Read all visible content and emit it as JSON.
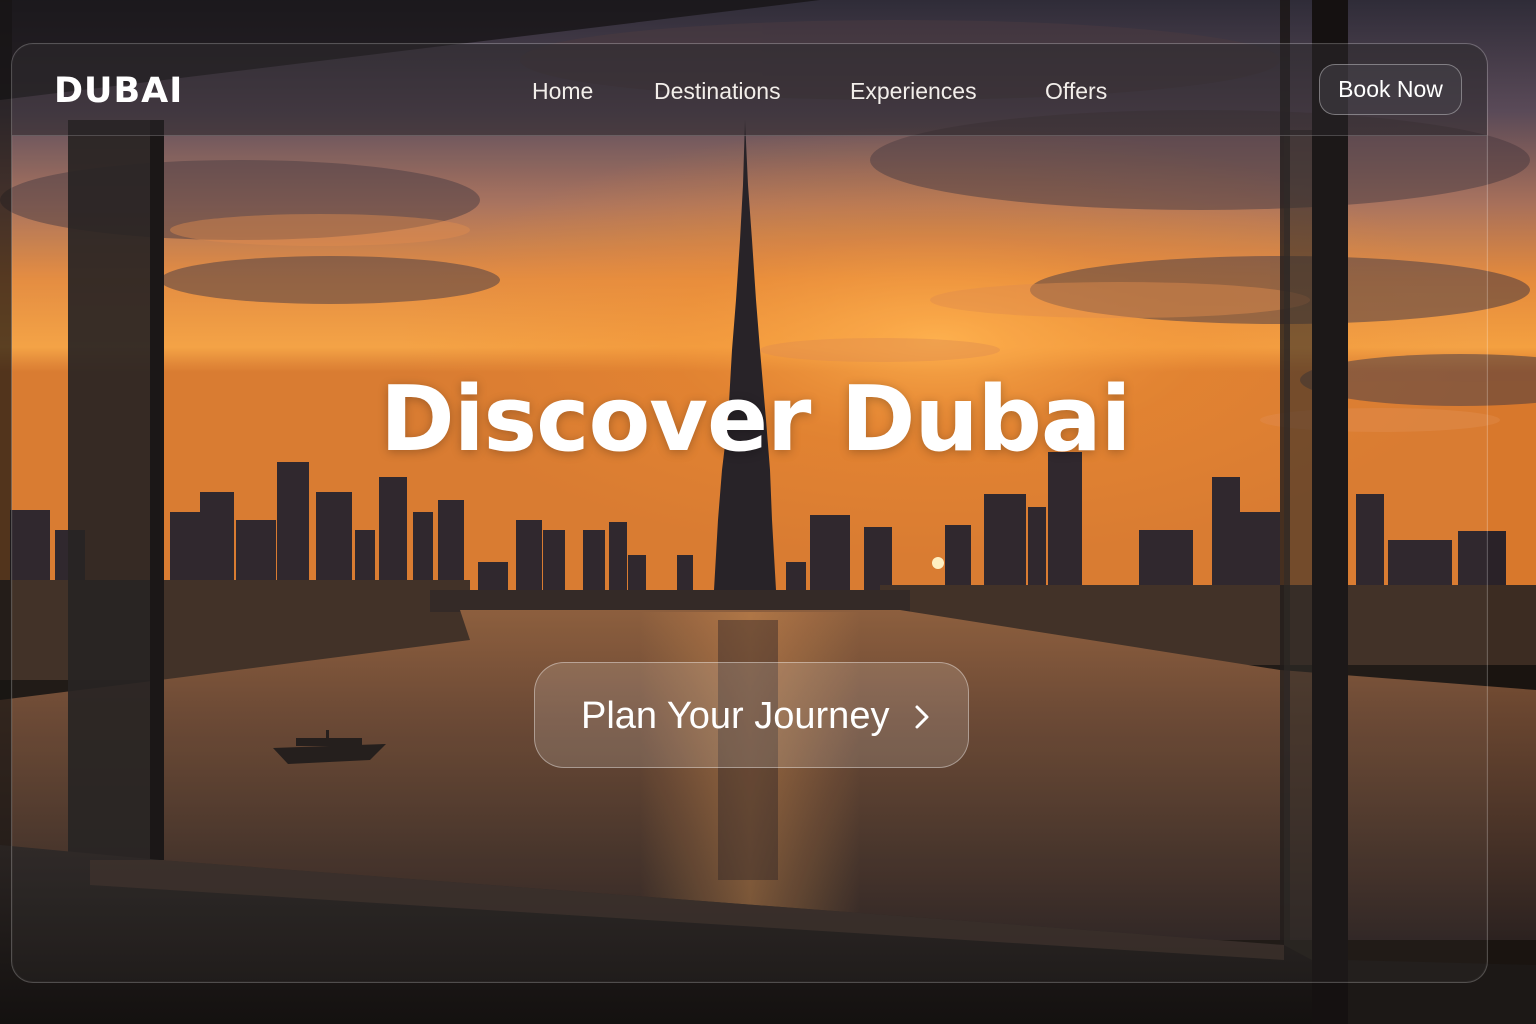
{
  "brand": {
    "logo_text": "DUBAI"
  },
  "nav": {
    "links": [
      "Home",
      "Destinations",
      "Experiences",
      "Offers"
    ],
    "book_label": "Book Now"
  },
  "hero": {
    "title": "Discover Dubai",
    "cta_label": "Plan Your Journey",
    "cta_icon": "chevron-right-icon",
    "background": "dubai-skyline-sunset-photo"
  },
  "colors": {
    "text": "#ffffff",
    "sky_top": "#3a3440",
    "sunset_orange": "#f08a2a",
    "water": "#3a2a22"
  }
}
